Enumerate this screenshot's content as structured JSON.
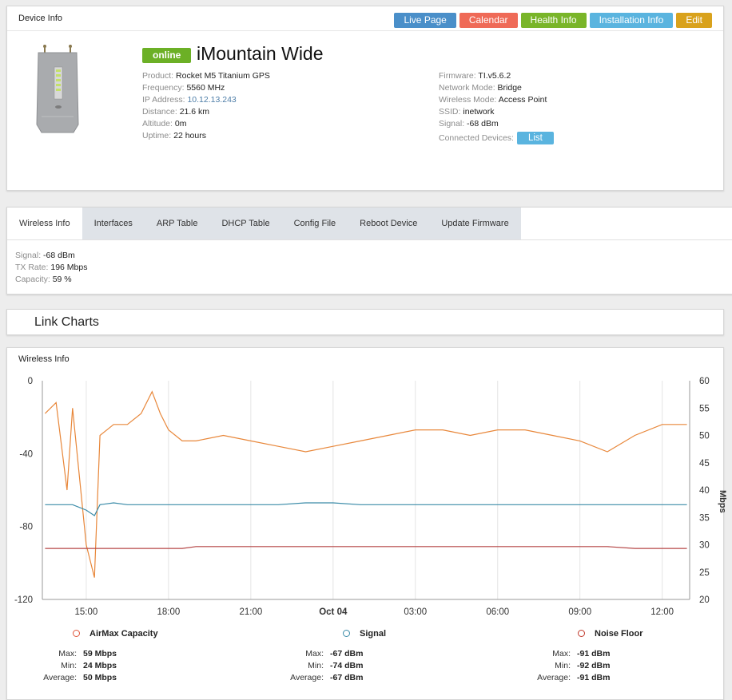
{
  "device_panel": {
    "title": "Device Info",
    "buttons": [
      {
        "label": "Live Page",
        "color": "#4a8fc9"
      },
      {
        "label": "Calendar",
        "color": "#ef6a57"
      },
      {
        "label": "Health Info",
        "color": "#79b529"
      },
      {
        "label": "Installation Info",
        "color": "#5ab4df"
      },
      {
        "label": "Edit",
        "color": "#d9a21c"
      }
    ],
    "status": "online",
    "name": "iMountain Wide",
    "left_info": [
      {
        "label": "Product:",
        "value": "Rocket M5 Titanium GPS"
      },
      {
        "label": "Frequency:",
        "value": "5560 MHz"
      },
      {
        "label": "IP Address:",
        "value": "10.12.13.243"
      },
      {
        "label": "Distance:",
        "value": "21.6 km"
      },
      {
        "label": "Altitude:",
        "value": "0m"
      },
      {
        "label": "Uptime:",
        "value": "22 hours"
      }
    ],
    "right_info": [
      {
        "label": "Firmware:",
        "value": "TI.v5.6.2"
      },
      {
        "label": "Network Mode:",
        "value": "Bridge"
      },
      {
        "label": "Wireless Mode:",
        "value": "Access Point"
      },
      {
        "label": "SSID:",
        "value": "inetwork"
      },
      {
        "label": "Signal:",
        "value": "-68 dBm"
      },
      {
        "label": "Connected Devices:",
        "value": ""
      }
    ],
    "list_button": "List"
  },
  "tabs": [
    "Wireless Info",
    "Interfaces",
    "ARP Table",
    "DHCP Table",
    "Config File",
    "Reboot Device",
    "Update Firmware"
  ],
  "wireless_info": [
    {
      "label": "Signal:",
      "value": "-68 dBm"
    },
    {
      "label": "TX Rate:",
      "value": "196 Mbps"
    },
    {
      "label": "Capacity:",
      "value": "59 %"
    }
  ],
  "link_charts_title": "Link Charts",
  "chart_panel_title": "Wireless Info",
  "chart_data": {
    "type": "line",
    "x_ticks": [
      "15:00",
      "18:00",
      "21:00",
      "Oct 04",
      "03:00",
      "06:00",
      "09:00",
      "12:00"
    ],
    "y_left_ticks": [
      "0",
      "-40",
      "-80",
      "-120"
    ],
    "y_left_range": [
      -120,
      0
    ],
    "y_right_ticks": [
      "60",
      "55",
      "50",
      "45",
      "40",
      "35",
      "30",
      "25",
      "20"
    ],
    "y_right_range": [
      20,
      60
    ],
    "y_right_label": "Mbps",
    "grid": "vertical",
    "x": [
      13.5,
      13.9,
      14.3,
      14.5,
      15.0,
      15.3,
      15.5,
      16.0,
      16.5,
      17.0,
      17.4,
      17.7,
      18.0,
      18.5,
      19.0,
      20.0,
      21.0,
      22.0,
      23.0,
      24.0,
      25.0,
      26.0,
      27.0,
      28.0,
      29.0,
      30.0,
      31.0,
      32.0,
      33.0,
      34.0,
      35.0,
      36.0,
      36.9
    ],
    "series": [
      {
        "name": "AirMax Capacity",
        "axis": "right",
        "color": "#e8873a",
        "values": [
          54,
          56,
          40,
          55,
          30,
          24,
          50,
          52,
          52,
          54,
          58,
          54,
          51,
          49,
          49,
          50,
          49,
          48,
          47,
          48,
          49,
          50,
          51,
          51,
          50,
          51,
          51,
          50,
          49,
          47,
          50,
          52,
          52
        ]
      },
      {
        "name": "Signal",
        "axis": "left",
        "color": "#3a8ba8",
        "values": [
          -68,
          -68,
          -68,
          -68,
          -71,
          -74,
          -68,
          -67,
          -68,
          -68,
          -68,
          -68,
          -68,
          -68,
          -68,
          -68,
          -68,
          -68,
          -67,
          -67,
          -68,
          -68,
          -68,
          -68,
          -68,
          -68,
          -68,
          -68,
          -68,
          -68,
          -68,
          -68,
          -68
        ]
      },
      {
        "name": "Noise Floor",
        "axis": "left",
        "color": "#b54747",
        "values": [
          -92,
          -92,
          -92,
          -92,
          -92,
          -92,
          -92,
          -92,
          -92,
          -92,
          -92,
          -92,
          -92,
          -92,
          -91,
          -91,
          -91,
          -91,
          -91,
          -91,
          -91,
          -91,
          -91,
          -91,
          -91,
          -91,
          -91,
          -91,
          -91,
          -91,
          -92,
          -92,
          -92
        ]
      }
    ],
    "stats": [
      {
        "name": "AirMax Capacity",
        "color": "#e0563b",
        "max": "59 Mbps",
        "min": "24 Mbps",
        "average": "50 Mbps"
      },
      {
        "name": "Signal",
        "color": "#3a8ba8",
        "max": "-67 dBm",
        "min": "-74 dBm",
        "average": "-67 dBm"
      },
      {
        "name": "Noise Floor",
        "color": "#c0392b",
        "max": "-91 dBm",
        "min": "-92 dBm",
        "average": "-91 dBm"
      }
    ],
    "stat_labels": {
      "max": "Max:",
      "min": "Min:",
      "average": "Average:"
    }
  }
}
